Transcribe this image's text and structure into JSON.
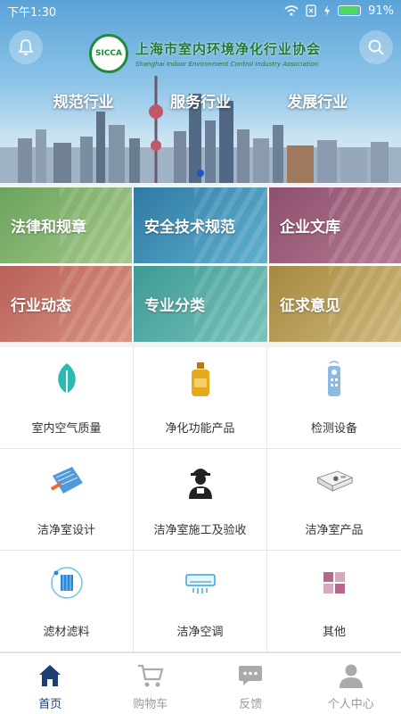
{
  "status_bar": {
    "time": "下午1:30",
    "battery": "91%"
  },
  "header": {
    "org_name_cn": "上海市室内环境净化行业协会",
    "org_name_en": "Shanghai Indoor Environment Control Industry Association",
    "logo_text": "SICCA",
    "slogans": [
      "规范行业",
      "服务行业",
      "发展行业"
    ],
    "carousel_pages": 1,
    "carousel_active": 1
  },
  "categories": [
    {
      "label": "法律和规章",
      "color": "#7bb06a"
    },
    {
      "label": "安全技术规范",
      "color": "#3f8fb4"
    },
    {
      "label": "企业文库",
      "color": "#a3607f"
    },
    {
      "label": "行业动态",
      "color": "#c9736b"
    },
    {
      "label": "专业分类",
      "color": "#4ba7a0"
    },
    {
      "label": "征求意见",
      "color": "#b59a52"
    }
  ],
  "products": [
    {
      "label": "室内空气质量",
      "icon": "leaf-icon"
    },
    {
      "label": "净化功能产品",
      "icon": "bottle-icon"
    },
    {
      "label": "检测设备",
      "icon": "remote-icon"
    },
    {
      "label": "洁净室设计",
      "icon": "blueprint-icon"
    },
    {
      "label": "洁净室施工及验收",
      "icon": "worker-icon"
    },
    {
      "label": "洁净室产品",
      "icon": "device-icon"
    },
    {
      "label": "滤材滤料",
      "icon": "filter-icon"
    },
    {
      "label": "洁净空调",
      "icon": "air-conditioner-icon"
    },
    {
      "label": "其他",
      "icon": "grid-icon"
    }
  ],
  "tabbar": [
    {
      "label": "首页",
      "icon": "home-icon",
      "active": true
    },
    {
      "label": "购物车",
      "icon": "cart-icon",
      "active": false
    },
    {
      "label": "反馈",
      "icon": "chat-icon",
      "active": false
    },
    {
      "label": "个人中心",
      "icon": "person-icon",
      "active": false
    }
  ],
  "colors": {
    "accent": "#1d3e73",
    "brand_green": "#1d7a33",
    "inactive": "#999999"
  }
}
